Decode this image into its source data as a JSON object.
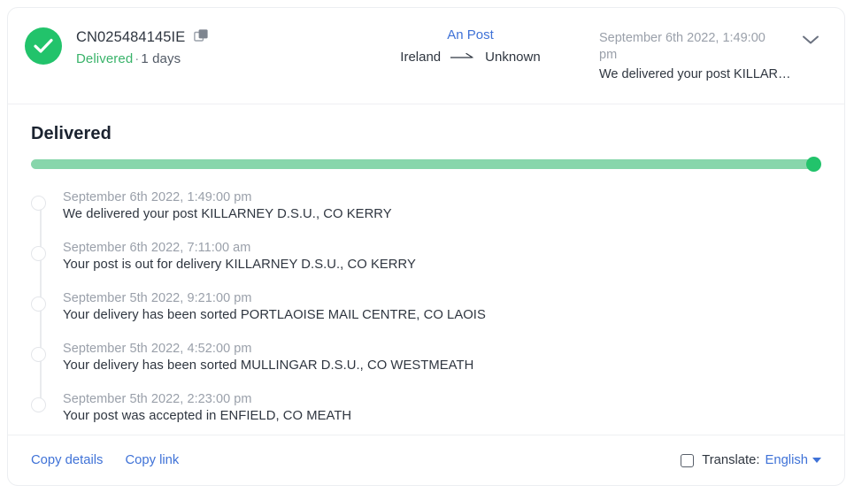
{
  "header": {
    "status_icon": "check-circle-icon",
    "tracking_number": "CN025484145IE",
    "copy_icon": "copy-icon",
    "status_label": "Delivered",
    "separator": "·",
    "duration": "1 days",
    "carrier": "An Post",
    "origin": "Ireland",
    "arrow_icon": "arrow-right-icon",
    "destination": "Unknown",
    "last_event_time": "September 6th 2022, 1:49:00 pm",
    "last_event_message": "We delivered your post KILLAR…",
    "expand_icon": "chevron-down-icon"
  },
  "main": {
    "section_title": "Delivered",
    "progress_percent": 100,
    "progress_color": "#87d6ab",
    "progress_knob_color": "#22c36b",
    "events": [
      {
        "time": "September 6th 2022, 1:49:00 pm",
        "message": "We delivered your post KILLARNEY D.S.U., CO KERRY"
      },
      {
        "time": "September 6th 2022, 7:11:00 am",
        "message": "Your post is out for delivery KILLARNEY D.S.U., CO KERRY"
      },
      {
        "time": "September 5th 2022, 9:21:00 pm",
        "message": "Your delivery has been sorted PORTLAOISE MAIL CENTRE, CO LAOIS"
      },
      {
        "time": "September 5th 2022, 4:52:00 pm",
        "message": "Your delivery has been sorted MULLINGAR D.S.U., CO WESTMEATH"
      },
      {
        "time": "September 5th 2022, 2:23:00 pm",
        "message": "Your post was accepted in ENFIELD, CO MEATH"
      }
    ]
  },
  "footer": {
    "copy_details_label": "Copy details",
    "copy_link_label": "Copy link",
    "translate_checked": false,
    "translate_label": "Translate:",
    "translate_language": "English",
    "caret_icon": "caret-down-icon"
  },
  "colors": {
    "success_green": "#22c36b",
    "link_blue": "#3f72d7",
    "text_dark": "#2f3640",
    "text_muted": "#9aa0aa",
    "border": "#eceef1"
  }
}
